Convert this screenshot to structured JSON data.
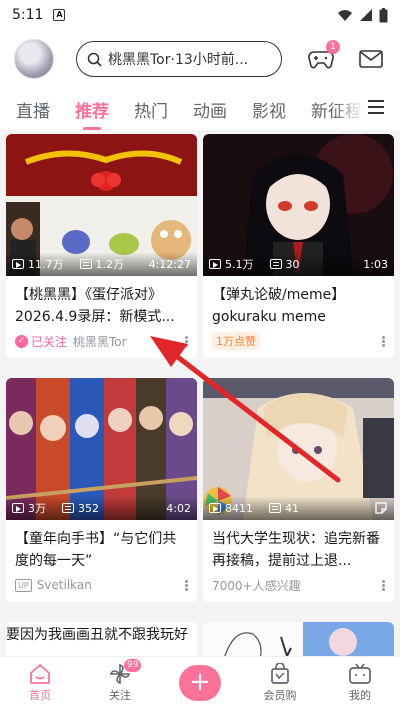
{
  "status": {
    "time": "5:11",
    "a_icon": "A"
  },
  "header": {
    "search_placeholder": "桃黑黑Tor·13小时前...",
    "game_badge": "1"
  },
  "tabs": [
    "直播",
    "推荐",
    "热门",
    "动画",
    "影视",
    "新征程"
  ],
  "active_tab": 1,
  "cards": [
    {
      "views": "11.7万",
      "danmaku": "1.2万",
      "duration": "4:12:27",
      "title": "【桃黑黑】《蛋仔派对》2026.4.9录屏：新模式...",
      "follow_label": "已关注",
      "author": "桃黑黑Tor"
    },
    {
      "views": "5.1万",
      "danmaku": "30",
      "duration": "1:03",
      "title": "【弹丸论破/meme】gokuraku meme",
      "likes_label": "1万点赞"
    },
    {
      "views": "3万",
      "danmaku": "352",
      "duration": "4:02",
      "title": "【童年向手书】“与它们共度的每一天”",
      "up_label": "UP",
      "author": "Svetilkan"
    },
    {
      "views": "8411",
      "danmaku": "41",
      "duration": "",
      "title": "当代大学生现状：追完新番再接稿，提前过上退...",
      "author": "7000+人感兴趣"
    }
  ],
  "partial_row": {
    "left_text": "要因为我画画丑就不跟我玩好"
  },
  "bottom_nav": {
    "home": "首页",
    "follow": "关注",
    "follow_badge": "99",
    "publish": "+",
    "mall": "会员购",
    "me": "我的"
  }
}
